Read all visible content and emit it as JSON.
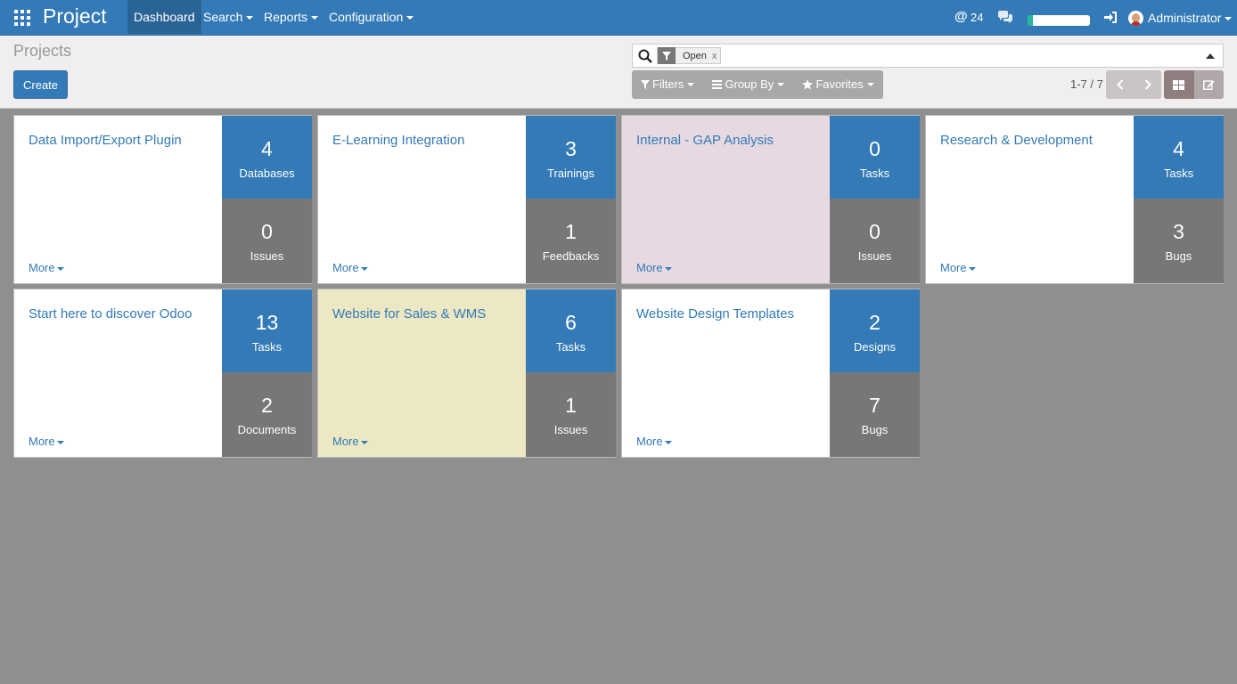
{
  "app": {
    "title": "Project",
    "menu": [
      "Dashboard",
      "Search",
      "Reports",
      "Configuration"
    ],
    "mentions_count": "24",
    "progress_fill": 0.08,
    "progress_color": "#21b799",
    "user_name": "Administrator",
    "accent_color": "#337ab7"
  },
  "control_panel": {
    "title": "Projects",
    "create_label": "Create",
    "search_facet": "Open",
    "search_facet_remove": "x",
    "filters_label": "Filters",
    "group_by_label": "Group By",
    "favorites_label": "Favorites",
    "pager_value": "1-7 / 7"
  },
  "projects": [
    {
      "title": "Data Import/Export Plugin",
      "top_count": "4",
      "top_label": "Databases",
      "bottom_count": "0",
      "bottom_label": "Issues",
      "more_label": "More",
      "color": "#ffffff"
    },
    {
      "title": "E-Learning Integration",
      "top_count": "3",
      "top_label": "Trainings",
      "bottom_count": "1",
      "bottom_label": "Feedbacks",
      "more_label": "More",
      "color": "#ffffff"
    },
    {
      "title": "Internal - GAP Analysis",
      "top_count": "0",
      "top_label": "Tasks",
      "bottom_count": "0",
      "bottom_label": "Issues",
      "more_label": "More",
      "color": "#e6d9e2"
    },
    {
      "title": "Research & Development",
      "top_count": "4",
      "top_label": "Tasks",
      "bottom_count": "3",
      "bottom_label": "Bugs",
      "more_label": "More",
      "color": "#ffffff"
    },
    {
      "title": "Start here to discover Odoo",
      "top_count": "13",
      "top_label": "Tasks",
      "bottom_count": "2",
      "bottom_label": "Documents",
      "more_label": "More",
      "color": "#ffffff"
    },
    {
      "title": "Website for Sales & WMS",
      "top_count": "6",
      "top_label": "Tasks",
      "bottom_count": "1",
      "bottom_label": "Issues",
      "more_label": "More",
      "color": "#ece8c3"
    },
    {
      "title": "Website Design Templates",
      "top_count": "2",
      "top_label": "Designs",
      "bottom_count": "7",
      "bottom_label": "Bugs",
      "more_label": "More",
      "color": "#ffffff"
    }
  ]
}
